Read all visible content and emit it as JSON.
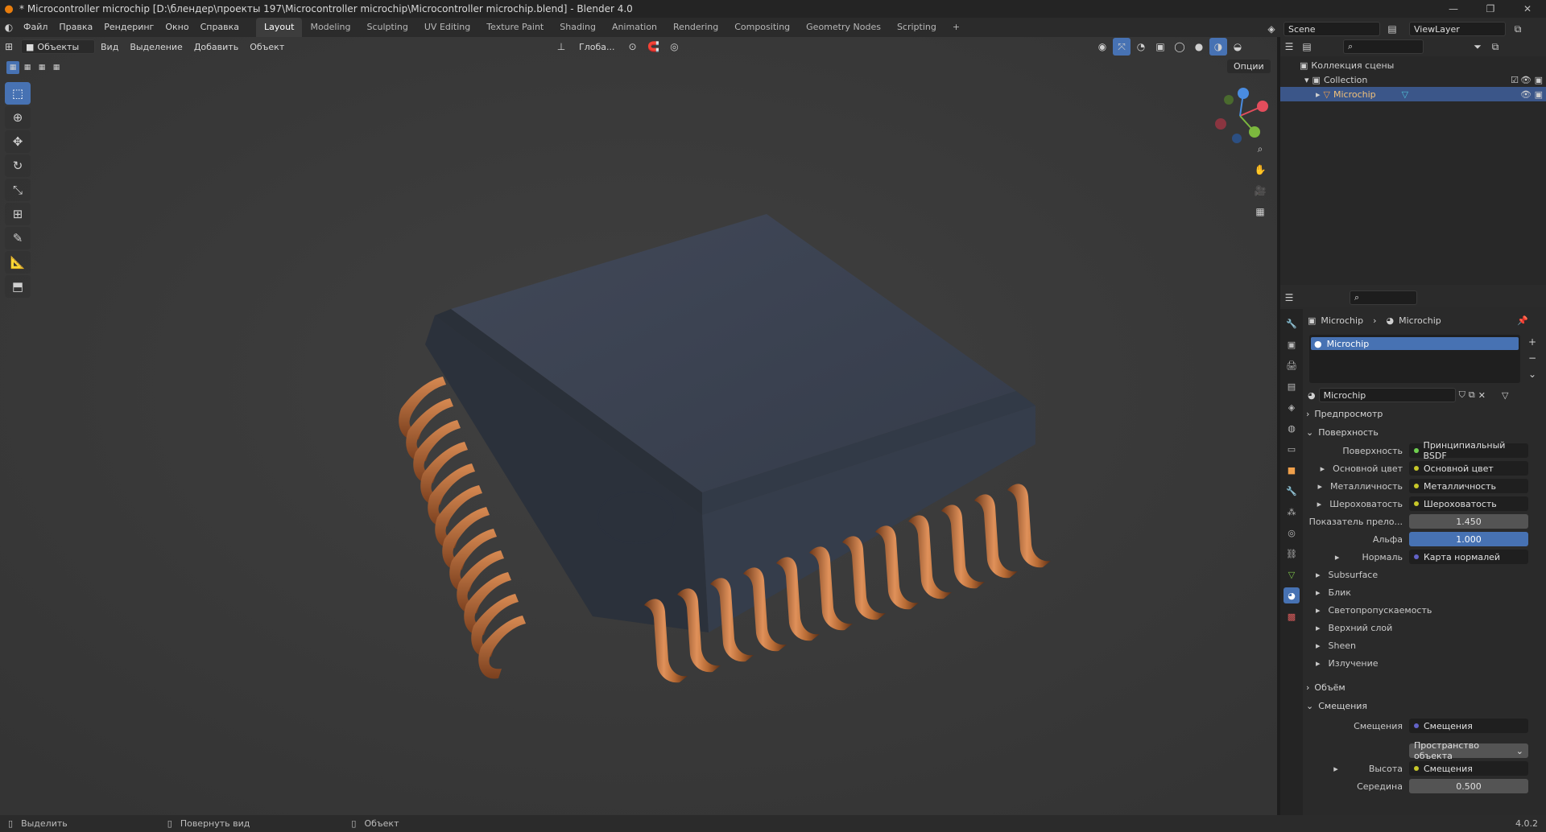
{
  "window": {
    "title": "* Microcontroller microchip [D:\\блендер\\проекты 197\\Microcontroller microchip\\Microcontroller microchip.blend] - Blender 4.0"
  },
  "menu": [
    "Файл",
    "Правка",
    "Рендеринг",
    "Окно",
    "Справка"
  ],
  "workspaces": [
    "Layout",
    "Modeling",
    "Sculpting",
    "UV Editing",
    "Texture Paint",
    "Shading",
    "Animation",
    "Rendering",
    "Compositing",
    "Geometry Nodes",
    "Scripting"
  ],
  "scene": {
    "name": "Scene",
    "view_layer": "ViewLayer"
  },
  "viewport_header": {
    "mode": "Объекты",
    "menus": [
      "Вид",
      "Выделение",
      "Добавить",
      "Объект"
    ],
    "transform_orientation": "Глоба...",
    "options": "Опции"
  },
  "outliner": {
    "root": "Коллекция сцены",
    "collection": "Collection",
    "object": "Microchip"
  },
  "properties": {
    "breadcrumb": [
      "Microchip",
      "Microchip"
    ],
    "material_slot": "Microchip",
    "material_name": "Microchip",
    "sections": {
      "preview": "Предпросмотр",
      "surface": "Поверхность",
      "volume": "Объём",
      "displacement": "Смещения"
    },
    "surface_shader": {
      "label": "Поверхность",
      "value": "Принципиальный BSDF"
    },
    "inputs": [
      {
        "label": "Основной цвет",
        "value": "Основной цвет",
        "dot": "#c7c729"
      },
      {
        "label": "Металличность",
        "value": "Металличность",
        "dot": "#c7c729"
      },
      {
        "label": "Шероховатость",
        "value": "Шероховатость",
        "dot": "#c7c729"
      }
    ],
    "ior": {
      "label": "Показатель прело...",
      "value": "1.450"
    },
    "alpha": {
      "label": "Альфа",
      "value": "1.000"
    },
    "normal": {
      "label": "Нормаль",
      "value": "Карта нормалей"
    },
    "subpanels": [
      "Subsurface",
      "Блик",
      "Светопропускаемость",
      "Верхний слой",
      "Sheen",
      "Излучение"
    ],
    "displacement": {
      "label": "Смещения",
      "value": "Смещения",
      "space": "Пространство объекта",
      "height_label": "Высота",
      "height_value": "Смещения",
      "mid_label": "Середина",
      "mid_value": "0.500"
    }
  },
  "statusbar": {
    "select": "Выделить",
    "rotate": "Повернуть вид",
    "object": "Объект",
    "version": "4.0.2"
  },
  "colors": {
    "accent": "#4772b3",
    "chip_body": "#3c4350",
    "copper": "#c87a3e",
    "viewport_bg": "#3a3a3a"
  }
}
